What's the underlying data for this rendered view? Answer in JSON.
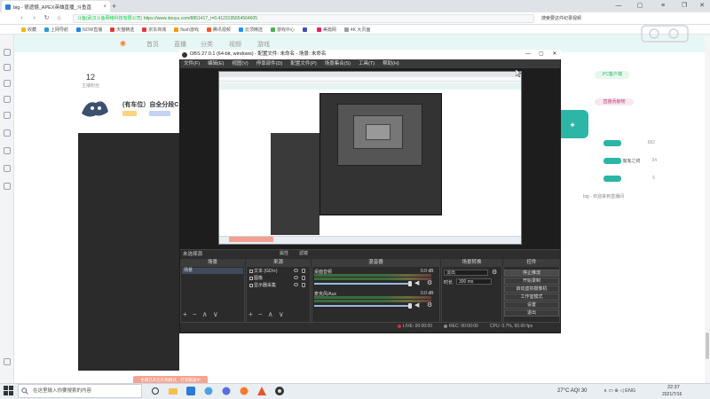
{
  "browser": {
    "tab_title": "big - 很遗憾_APEX英雄直播_斗鱼直",
    "new_tab": "+",
    "url_host": "斗鱼(武汉斗鱼网络科技有限公司)",
    "url": "https://www.douyu.com/8851417_r=0.4123195654564605",
    "search_hint": "搜索要这件纪录视频"
  },
  "bookmarks": [
    {
      "label": "收藏",
      "color": "#f2b705"
    },
    {
      "label": "上网导航",
      "color": "#2a9bd8"
    },
    {
      "label": "NOW直播",
      "color": "#1e88e5"
    },
    {
      "label": "天猫精选",
      "color": "#e53935"
    },
    {
      "label": "京东商城",
      "color": "#e53935"
    },
    {
      "label": "flash游戏",
      "color": "#ff9800"
    },
    {
      "label": "腾讯视频",
      "color": "#ff5722"
    },
    {
      "label": "云顶精选",
      "color": "#2196f3"
    },
    {
      "label": "游戏中心",
      "color": "#4caf50"
    },
    {
      "label": "",
      "color": "#3f51b5"
    },
    {
      "label": "美篇网",
      "color": "#e91e63"
    },
    {
      "label": "4K 大页面",
      "color": "#9e9e9e"
    }
  ],
  "douyu": {
    "nav_items": [
      "首页",
      "直播",
      "分类",
      "视频",
      "游戏"
    ],
    "follower_count": "12",
    "follower_label": "主播粉丝",
    "room_title": "(有车位）自全分段C",
    "pc_button": "PC客户端",
    "rank_tag": "直播贡献榜",
    "rank_rows": [
      {
        "name": "",
        "value": "682"
      },
      {
        "name": "魔鬼之镜",
        "value": ""
      },
      {
        "name": "",
        "value": "34"
      },
      {
        "name": "",
        "value": "5"
      }
    ],
    "chat_note": "big - 欢迎来到直播间",
    "bottom_button": "主播已开启礼物模式，打赏赠送中"
  },
  "obs": {
    "title": "OBS 27.0.1 (64-bit, windows) - 配置文件: 未命名 - 场景: 未命名",
    "menu": [
      "文件(F)",
      "编辑(E)",
      "视图(V)",
      "停靠部件(D)",
      "配置文件(P)",
      "场景集合(S)",
      "工具(T)",
      "帮助(H)"
    ],
    "status_line": "未选择源",
    "filter_label": "属性",
    "prop_label": "滤镜",
    "docks": {
      "scenes": "场景",
      "sources": "来源",
      "mixer": "混音器",
      "transitions": "场景转换",
      "controls": "控件"
    },
    "scene_item": "场景",
    "sources": [
      "文本 (GDI+)",
      "图像",
      "显示器采集"
    ],
    "mixer": [
      {
        "name": "桌面音频",
        "db": "0.0 dB"
      },
      {
        "name": "麦克风/Aux",
        "db": "0.0 dB"
      }
    ],
    "transitions": {
      "type": "淡出",
      "duration_label": "时长",
      "duration": "300 ms"
    },
    "controls": [
      "停止推流",
      "开始录制",
      "启动虚拟摄像机",
      "工作室模式",
      "设置",
      "退出"
    ],
    "statusbar": {
      "live": "LIVE: 00:00:00",
      "rec": "REC: 00:00:00",
      "cpu": "CPU: 0.7%, 60.00 fps"
    },
    "foot_controls": "+ − ∧ ∨"
  },
  "taskbar": {
    "search_placeholder": "在这里输入你要搜索的内容",
    "temp": "27°C AQI 30",
    "tray": "∧ ▭ ⊕ ◁ ENG",
    "time": "22:37",
    "date": "2021/7/16"
  }
}
